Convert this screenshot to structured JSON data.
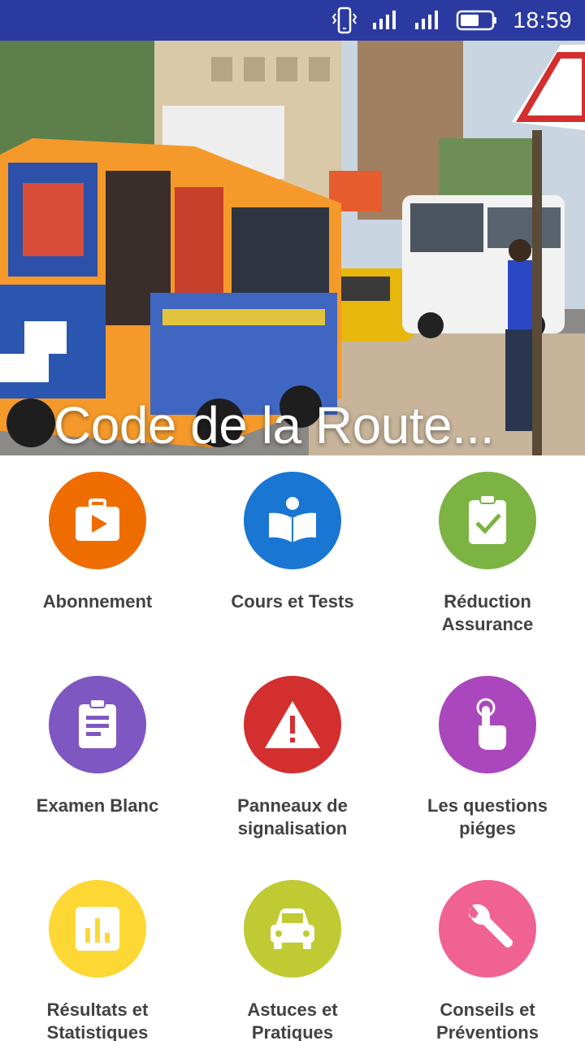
{
  "status_bar": {
    "time": "18:59",
    "icons": [
      "phone-vibrate-icon",
      "signal-icon",
      "signal-icon",
      "battery-icon"
    ]
  },
  "hero": {
    "title": "Code de la Route..."
  },
  "menu": {
    "items": [
      {
        "label_lines": [
          "Abonnement"
        ],
        "icon": "briefcase-play-icon",
        "color": "#ef6c00"
      },
      {
        "label_lines": [
          "Cours et Tests"
        ],
        "icon": "reader-book-icon",
        "color": "#1976d2"
      },
      {
        "label_lines": [
          "Réduction",
          "Assurance"
        ],
        "icon": "clipboard-check-icon",
        "color": "#7cb342"
      },
      {
        "label_lines": [
          "Examen Blanc"
        ],
        "icon": "clipboard-list-icon",
        "color": "#7e57c2"
      },
      {
        "label_lines": [
          "Panneaux de",
          "signalisation"
        ],
        "icon": "warning-triangle-icon",
        "color": "#d32f2f"
      },
      {
        "label_lines": [
          "Les questions",
          "piéges"
        ],
        "icon": "touch-hand-icon",
        "color": "#ab47bc"
      },
      {
        "label_lines": [
          "Résultats et",
          "Statistiques"
        ],
        "icon": "bar-chart-icon",
        "color": "#fdd835"
      },
      {
        "label_lines": [
          "Astuces et",
          "Pratiques"
        ],
        "icon": "car-icon",
        "color": "#c0ca33"
      },
      {
        "label_lines": [
          "Conseils et",
          "Préventions"
        ],
        "icon": "wrench-icon",
        "color": "#f06292"
      }
    ]
  }
}
